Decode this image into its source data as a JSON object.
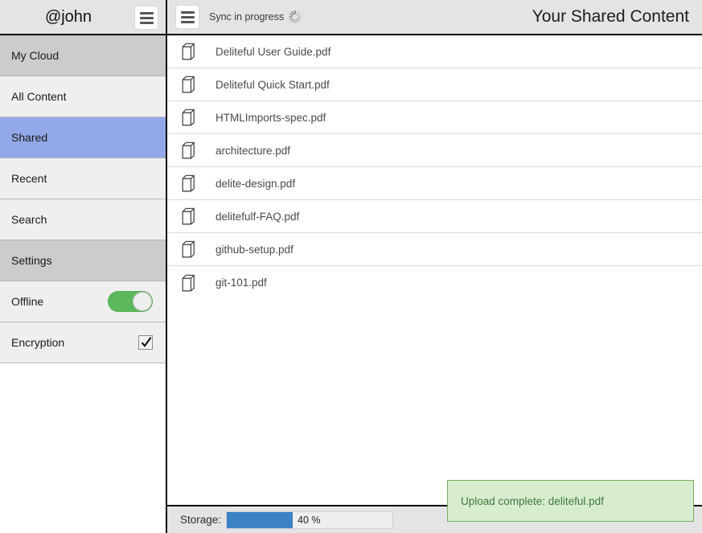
{
  "header": {
    "user": "@john",
    "menu_icon": "hamburger-icon",
    "sync_status": "Sync in progress",
    "sync_icon": "spinner-icon",
    "title": "Your Shared Content"
  },
  "sidebar": {
    "nav": [
      {
        "label": "My Cloud",
        "style": "header-row",
        "selected": false
      },
      {
        "label": "All Content",
        "style": "plain",
        "selected": false
      },
      {
        "label": "Shared",
        "style": "selected",
        "selected": true
      },
      {
        "label": "Recent",
        "style": "plain",
        "selected": false
      },
      {
        "label": "Search",
        "style": "plain",
        "selected": false
      },
      {
        "label": "Settings",
        "style": "header-row",
        "selected": false
      }
    ],
    "settings": {
      "offline_label": "Offline",
      "offline_value": "on",
      "offline_color": "#5cb85c",
      "encryption_label": "Encryption",
      "encryption_value": "checked"
    }
  },
  "main": {
    "files": [
      {
        "name": "Deliteful User Guide.pdf",
        "icon": "file-icon"
      },
      {
        "name": "Deliteful Quick Start.pdf",
        "icon": "file-icon"
      },
      {
        "name": "HTMLImports-spec.pdf",
        "icon": "file-icon"
      },
      {
        "name": "architecture.pdf",
        "icon": "file-icon"
      },
      {
        "name": "delite-design.pdf",
        "icon": "file-icon"
      },
      {
        "name": "delitefulf-FAQ.pdf",
        "icon": "file-icon"
      },
      {
        "name": "github-setup.pdf",
        "icon": "file-icon"
      },
      {
        "name": "git-101.pdf",
        "icon": "file-icon"
      }
    ]
  },
  "statusbar": {
    "storage_label": "Storage:",
    "storage_percent": "40 %",
    "storage_value": 40,
    "storage_color": "#3a82c4"
  },
  "toast": {
    "message": "Upload complete: deliteful.pdf",
    "background": "#d8ecd0",
    "border": "#74ae5e",
    "text_color": "#3f7a3b"
  }
}
